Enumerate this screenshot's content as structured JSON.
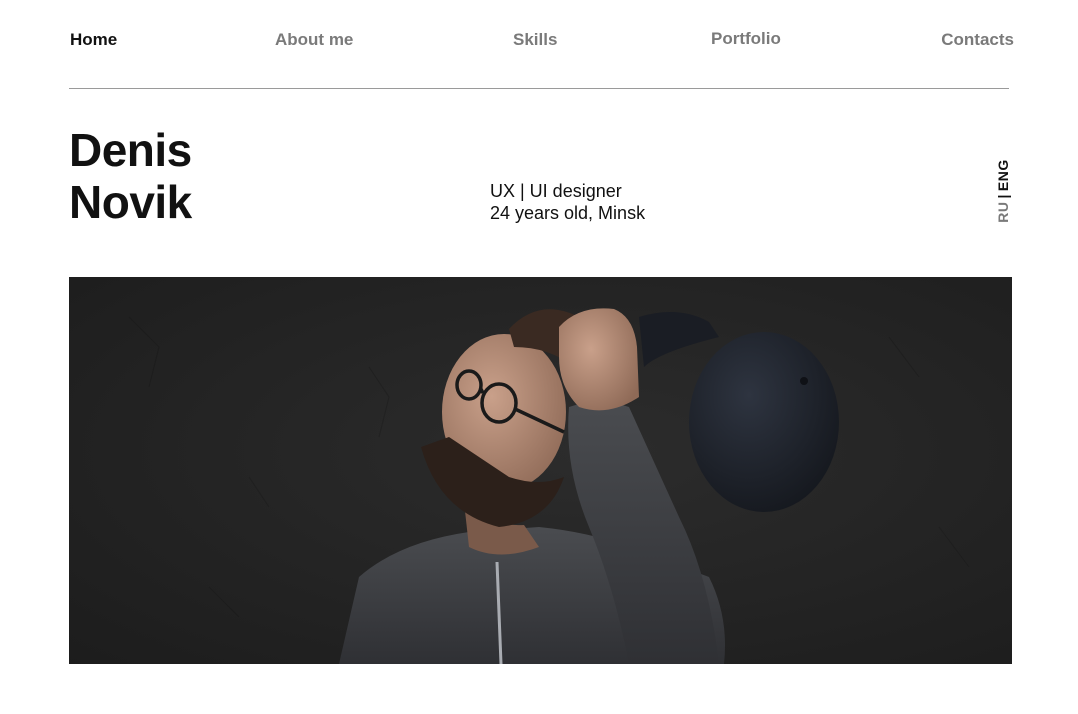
{
  "nav": {
    "items": [
      {
        "label": "Home",
        "active": true
      },
      {
        "label": "About me",
        "active": false
      },
      {
        "label": "Skills",
        "active": false
      },
      {
        "label": "Portfolio",
        "active": false
      },
      {
        "label": "Contacts",
        "active": false
      }
    ]
  },
  "hero": {
    "first_name": "Denis",
    "last_name": "Novik",
    "role": "UX | UI designer",
    "details": "24 years old, Minsk"
  },
  "lang": {
    "ru": "RU",
    "separator": "|",
    "eng": "ENG",
    "active": "ENG"
  },
  "colors": {
    "text": "#111111",
    "muted": "#7a7a7a",
    "divider": "#9a9a9a",
    "photo_bg": "#262626"
  }
}
